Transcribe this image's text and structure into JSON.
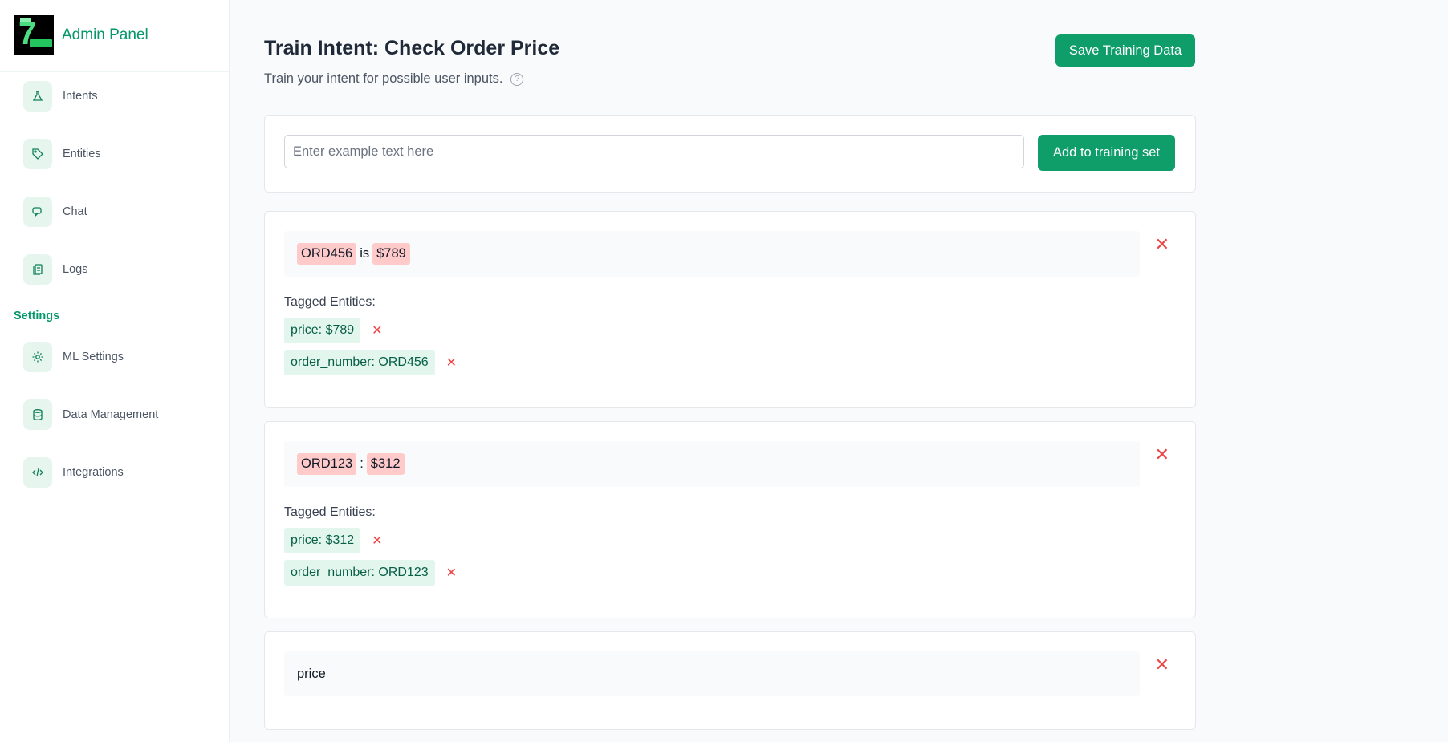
{
  "app": {
    "title": "Admin Panel"
  },
  "sidebar": {
    "items": [
      {
        "label": "Intents",
        "icon": "flask-icon"
      },
      {
        "label": "Entities",
        "icon": "tag-icon"
      },
      {
        "label": "Chat",
        "icon": "chat-icon"
      },
      {
        "label": "Logs",
        "icon": "logs-icon"
      }
    ],
    "settings_label": "Settings",
    "settings_items": [
      {
        "label": "ML Settings",
        "icon": "gear-icon"
      },
      {
        "label": "Data Management",
        "icon": "database-icon"
      },
      {
        "label": "Integrations",
        "icon": "code-icon"
      }
    ]
  },
  "header": {
    "title": "Train Intent: Check Order Price",
    "subtitle": "Train your intent for possible user inputs.",
    "save_label": "Save Training Data"
  },
  "input": {
    "placeholder": "Enter example text here",
    "value": "",
    "add_label": "Add to training set"
  },
  "examples": [
    {
      "parts": [
        "ORD456",
        "is",
        "$789"
      ],
      "tagged_label": "Tagged Entities:",
      "tags": [
        "price: $789",
        "order_number: ORD456"
      ]
    },
    {
      "parts": [
        "ORD123",
        ":",
        "$312"
      ],
      "tagged_label": "Tagged Entities:",
      "tags": [
        "price: $312",
        "order_number: ORD123"
      ]
    },
    {
      "text": "price"
    }
  ],
  "colors": {
    "accent": "#059669",
    "button": "#0f9d6a",
    "entity_highlight": "#fecaca",
    "tag_chip": "#e3f6ee",
    "delete": "#ef4444"
  }
}
